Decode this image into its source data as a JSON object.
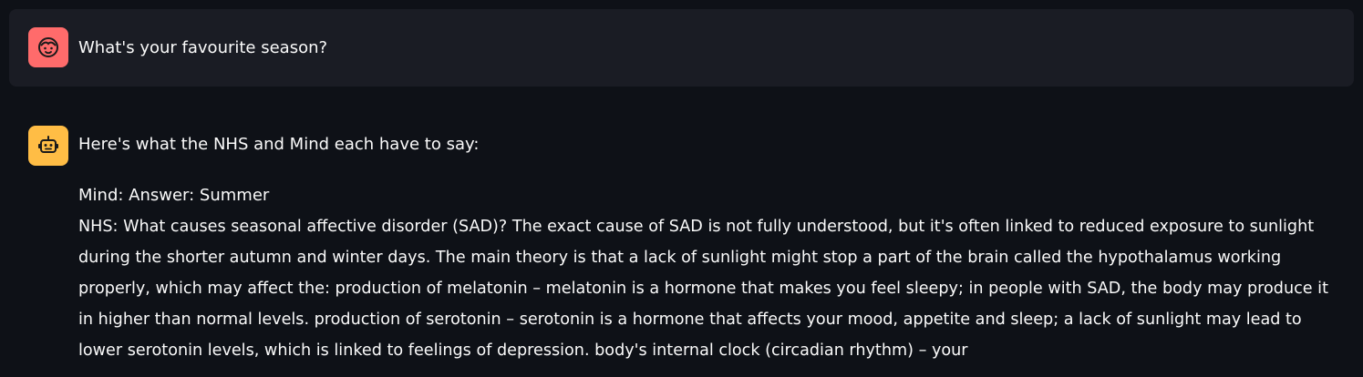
{
  "messages": {
    "user": {
      "avatar": "user-face-icon",
      "text": "What's your favourite season?",
      "accent": "#ff6b6b"
    },
    "assistant": {
      "avatar": "robot-icon",
      "accent": "#ffbd45",
      "intro": "Here's what the NHS and Mind each have to say:",
      "mind": "Mind: Answer: Summer",
      "nhs": "NHS: What causes seasonal affective disorder (SAD)? The exact cause of SAD is not fully understood, but it's often linked to reduced exposure to sunlight during the shorter autumn and winter days. The main theory is that a lack of sunlight might stop a part of the brain called the hypothalamus working properly, which may affect the: production of melatonin – melatonin is a hormone that makes you feel sleepy; in people with SAD, the body may produce it in higher than normal levels. production of serotonin – serotonin is a hormone that affects your mood, appetite and sleep; a lack of sunlight may lead to lower serotonin levels, which is linked to feelings of depression. body's internal clock (circadian rhythm) – your"
    }
  },
  "colors": {
    "background": "#0e1117",
    "user_bubble": "#1a1c24",
    "text": "#fafafa"
  }
}
